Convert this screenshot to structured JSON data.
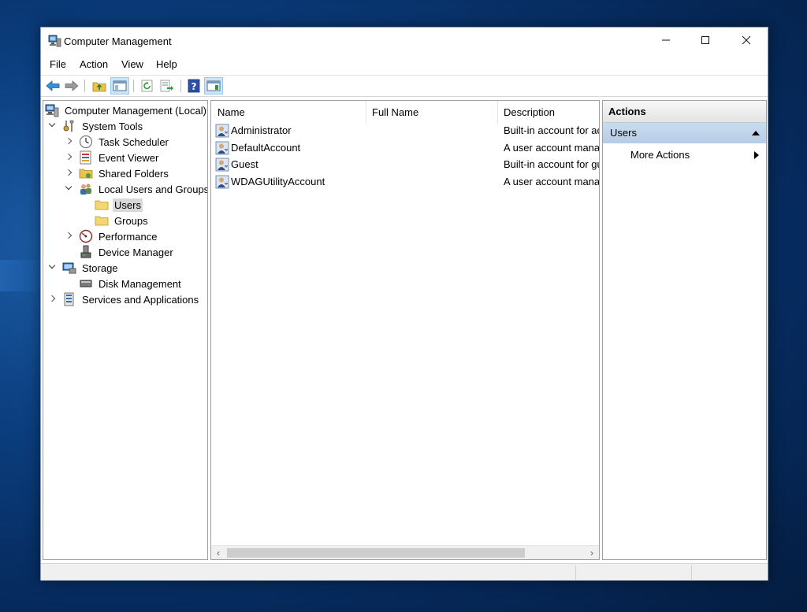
{
  "window": {
    "title": "Computer Management"
  },
  "menu": [
    "File",
    "Action",
    "View",
    "Help"
  ],
  "tree": [
    {
      "label": "Computer Management (Local)",
      "icon": "computer-management-icon",
      "arrow": "none",
      "level": 0
    },
    {
      "label": "System Tools",
      "icon": "system-tools-icon",
      "arrow": "down",
      "level": 1
    },
    {
      "label": "Task Scheduler",
      "icon": "task-scheduler-icon",
      "arrow": "right",
      "level": 2
    },
    {
      "label": "Event Viewer",
      "icon": "event-viewer-icon",
      "arrow": "right",
      "level": 2
    },
    {
      "label": "Shared Folders",
      "icon": "shared-folders-icon",
      "arrow": "right",
      "level": 2
    },
    {
      "label": "Local Users and Groups",
      "icon": "local-users-groups-icon",
      "arrow": "down",
      "level": 2
    },
    {
      "label": "Users",
      "icon": "folder-icon",
      "arrow": "none",
      "level": 3,
      "selected": true
    },
    {
      "label": "Groups",
      "icon": "folder-icon",
      "arrow": "none",
      "level": 3
    },
    {
      "label": "Performance",
      "icon": "performance-icon",
      "arrow": "right",
      "level": 2
    },
    {
      "label": "Device Manager",
      "icon": "device-manager-icon",
      "arrow": "none",
      "level": 2
    },
    {
      "label": "Storage",
      "icon": "storage-icon",
      "arrow": "down",
      "level": 1
    },
    {
      "label": "Disk Management",
      "icon": "disk-management-icon",
      "arrow": "none",
      "level": 2
    },
    {
      "label": "Services and Applications",
      "icon": "services-applications-icon",
      "arrow": "right",
      "level": 1
    }
  ],
  "list": {
    "columns": [
      "Name",
      "Full Name",
      "Description"
    ],
    "rows": [
      {
        "name": "Administrator",
        "full_name": "",
        "description": "Built-in account for ac"
      },
      {
        "name": "DefaultAccount",
        "full_name": "",
        "description": "A user account manag"
      },
      {
        "name": "Guest",
        "full_name": "",
        "description": "Built-in account for gu"
      },
      {
        "name": "WDAGUtilityAccount",
        "full_name": "",
        "description": "A user account manag"
      }
    ]
  },
  "actions": {
    "header": "Actions",
    "section": "Users",
    "items": [
      "More Actions"
    ]
  },
  "colors": {
    "selection_bg": "#d9d9d9",
    "actions_section_bg": "#c0d5ec",
    "toolbar_pressed_bg": "#cce4f7"
  }
}
